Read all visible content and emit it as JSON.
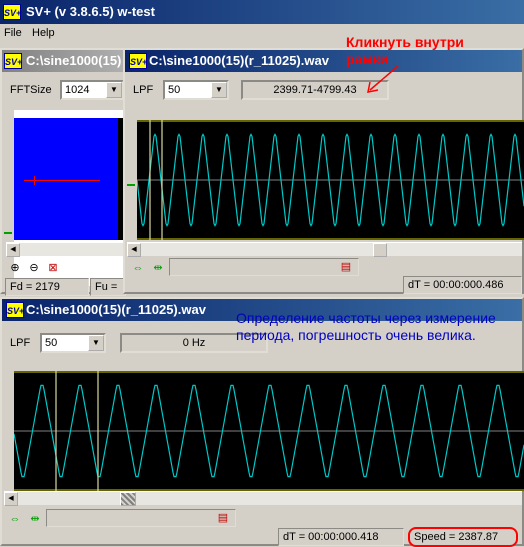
{
  "app": {
    "title": "SV+  (v 3.8.6.5) w-test",
    "icon_text": "SV+"
  },
  "menu": {
    "file": "File",
    "help": "Help"
  },
  "win_fft": {
    "title": "C:\\sine1000(15)",
    "fftsize_label": "FFTSize",
    "fftsize_value": "1024",
    "fd_text": "Fd = 2179",
    "fu_text": "Fu ="
  },
  "win_top": {
    "title": "C:\\sine1000(15)(r_11025).wav",
    "lpf_label": "LPF",
    "lpf_value": "50",
    "range_readout": "2399.71-4799.43",
    "dt_text": "dT = 00:00:000.486"
  },
  "win_bottom": {
    "title": "C:\\sine1000(15)(r_11025).wav",
    "lpf_label": "LPF",
    "lpf_value": "50",
    "freq_readout": "0 Hz",
    "dt_text": "dT = 00:00:000.418",
    "speed_text": "Speed = 2387.87"
  },
  "annotations": {
    "click_inside": "Кликнуть внутри рамки",
    "period_note": "Определение частоты через измерение периода, погрешность очень велика."
  },
  "colors": {
    "wave": "#00c8c8",
    "marker_line": "#d8d8a0",
    "green_line": "#00a000",
    "fft_bg": "#0000ff",
    "red_annot": "#ff0000"
  }
}
